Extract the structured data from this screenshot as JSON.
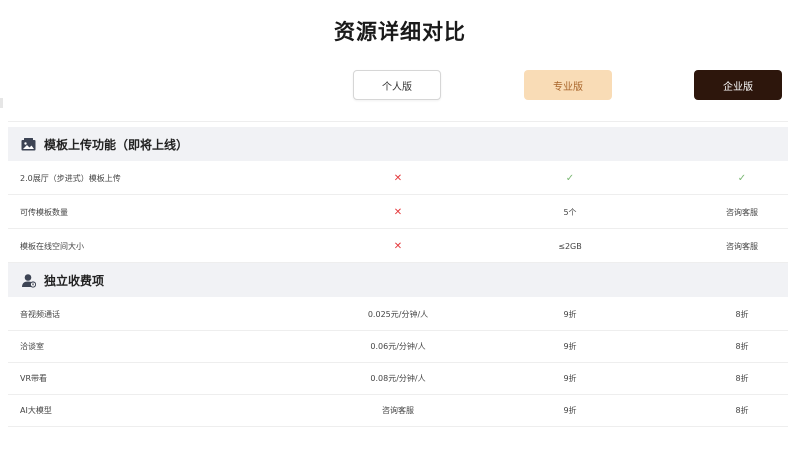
{
  "page": {
    "title": "资源详细对比"
  },
  "plans": {
    "personal": "个人版",
    "pro": "专业版",
    "enterprise": "企业版"
  },
  "sections": [
    {
      "title": "模板上传功能（即将上线）",
      "icon": "gallery-icon",
      "rows": [
        {
          "name": "2.0展厅（步进式）模板上传",
          "personal": "✕",
          "pro": "✓",
          "enterprise": "✓"
        },
        {
          "name": "可传模板数量",
          "personal": "✕",
          "pro": "5个",
          "enterprise": "咨询客服"
        },
        {
          "name": "模板在线空间大小",
          "personal": "✕",
          "pro": "≤2GB",
          "enterprise": "咨询客服"
        }
      ]
    },
    {
      "title": "独立收费项",
      "icon": "user-coin-icon",
      "rows": [
        {
          "name": "音视频通话",
          "personal": "0.025元/分钟/人",
          "pro": "9折",
          "enterprise": "8折"
        },
        {
          "name": "洽谈室",
          "personal": "0.06元/分钟/人",
          "pro": "9折",
          "enterprise": "8折"
        },
        {
          "name": "VR带看",
          "personal": "0.08元/分钟/人",
          "pro": "9折",
          "enterprise": "8折"
        },
        {
          "name": "AI大模型",
          "personal": "咨询客服",
          "pro": "9折",
          "enterprise": "8折"
        }
      ]
    }
  ],
  "colors": {
    "cross": "#e4393c",
    "check": "#7bb874",
    "pro_bg": "#f9dcb6",
    "enterprise_bg": "#2d160c"
  }
}
